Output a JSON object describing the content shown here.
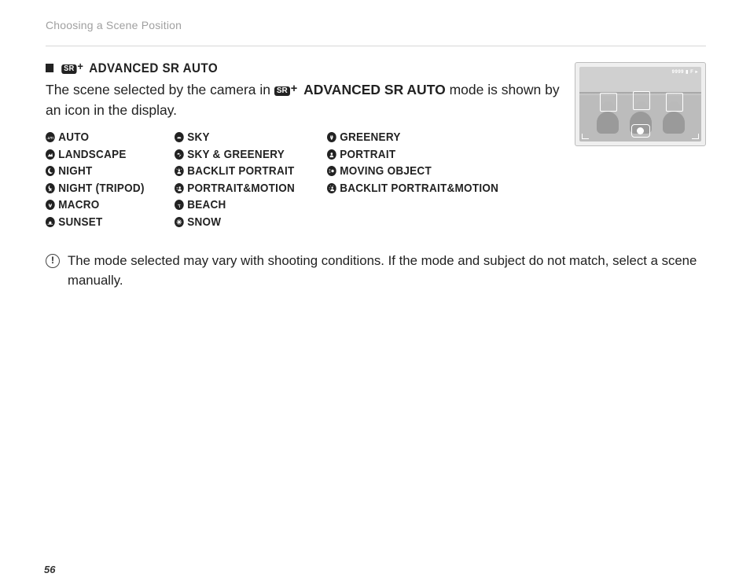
{
  "breadcrumb": "Choosing a Scene Position",
  "section": {
    "badge": "SR",
    "title": "ADVANCED SR AUTO",
    "intro_prefix": "The scene selected by the camera in ",
    "intro_badge": "SR",
    "intro_bold": "ADVANCED SR AUTO",
    "intro_suffix": " mode is shown by an icon in the display."
  },
  "scene_columns": [
    [
      "AUTO",
      "LANDSCAPE",
      "NIGHT",
      "NIGHT (TRIPOD)",
      "MACRO",
      "SUNSET"
    ],
    [
      "SKY",
      "SKY & GREENERY",
      "BACKLIT PORTRAIT",
      "PORTRAIT&MOTION",
      "BEACH",
      "SNOW"
    ],
    [
      "GREENERY",
      "PORTRAIT",
      "MOVING OBJECT",
      "BACKLIT PORTRAIT&MOTION"
    ]
  ],
  "note": "The mode selected may vary with shooting conditions.  If the mode and subject do not match, select a scene manually.",
  "page_number": "56"
}
